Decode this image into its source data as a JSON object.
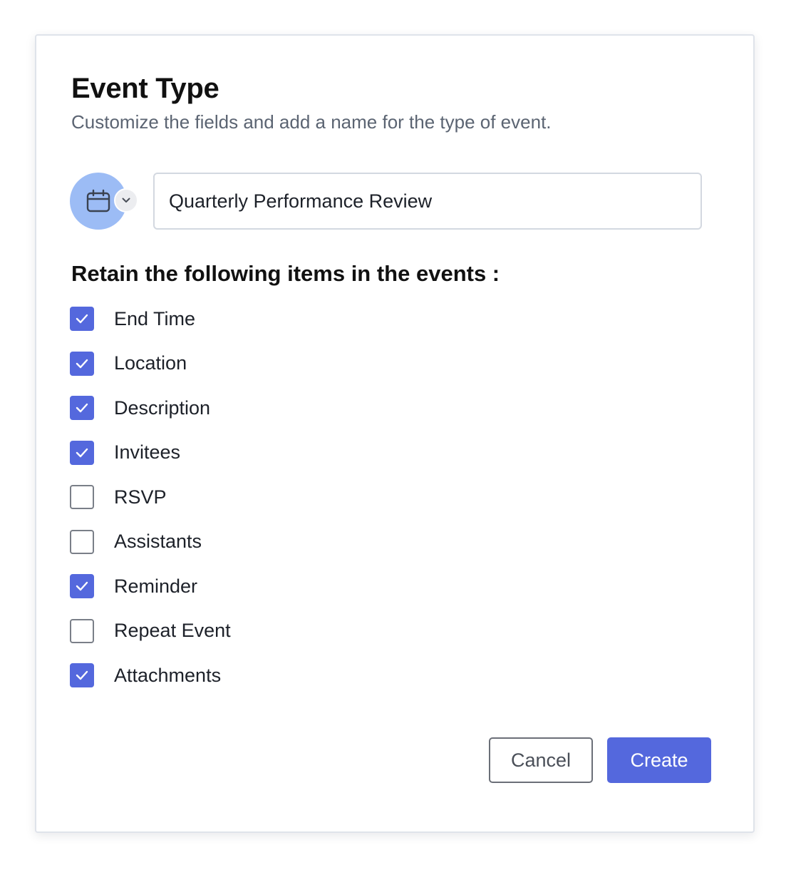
{
  "dialog": {
    "title": "Event Type",
    "subtitle": "Customize the fields and add a name for the type of event."
  },
  "icon_picker": {
    "icon": "calendar-icon",
    "dropdown_icon": "chevron-down-icon",
    "color": "#9cbcf5"
  },
  "name_field": {
    "value": "Quarterly Performance Review"
  },
  "retain_section": {
    "heading": "Retain the following items in the events :",
    "items": [
      {
        "label": "End Time",
        "checked": true
      },
      {
        "label": "Location",
        "checked": true
      },
      {
        "label": "Description",
        "checked": true
      },
      {
        "label": "Invitees",
        "checked": true
      },
      {
        "label": "RSVP",
        "checked": false
      },
      {
        "label": "Assistants",
        "checked": false
      },
      {
        "label": "Reminder",
        "checked": true
      },
      {
        "label": "Repeat Event",
        "checked": false
      },
      {
        "label": "Attachments",
        "checked": true
      }
    ]
  },
  "actions": {
    "cancel_label": "Cancel",
    "create_label": "Create"
  },
  "colors": {
    "accent": "#5468dd",
    "icon_circle": "#9cbcf5",
    "subtitle_text": "#5b6472"
  }
}
